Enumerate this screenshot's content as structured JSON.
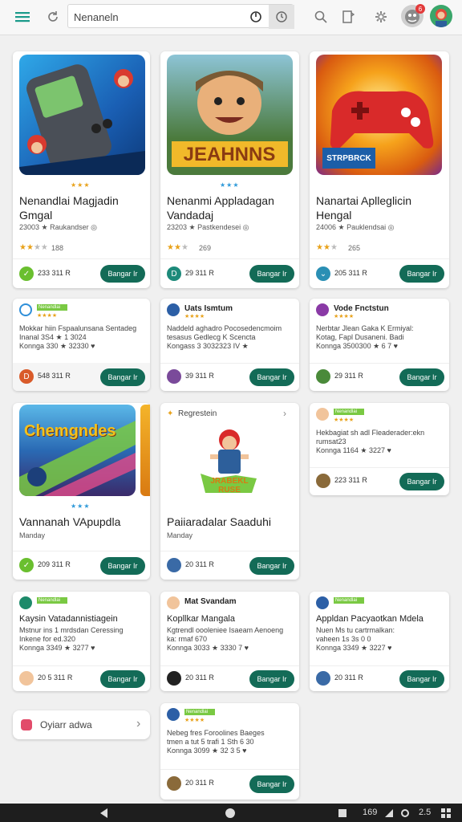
{
  "search": {
    "value": "Nenaneln"
  },
  "colors": {
    "accent": "#136b57",
    "star": "#e8a21b",
    "tag": "#7ac943"
  },
  "icons": {
    "menu": "hamburger-menu-icon",
    "refresh": "refresh-icon",
    "mic": "microphone-icon",
    "scan": "scan-icon",
    "search": "search-icon",
    "bookmark": "bookmark-icon",
    "settings": "gear-icon",
    "notifications": "bell-avatar-icon",
    "profile": "profile-avatar-icon"
  },
  "notification_count": "6",
  "featured": [
    {
      "title1": "Nenandlai Magjadin",
      "title2": "Gmgal",
      "meta": "23003 ★ Raukandser ◎",
      "stars": "★★",
      "grey": "★★",
      "count": "188",
      "price": "233 311 R",
      "button": "Bangar Ir"
    },
    {
      "title1": "Nenanmi Appladagan",
      "title2": "Vandadaj",
      "meta": "23203 ★ Pastkendesei ◎",
      "stars": "★★",
      "grey": "★",
      "count": "269",
      "price": "29 311 R",
      "button": "Bangar Ir"
    },
    {
      "title1": "Nanartai Aplleglicin",
      "title2": "Hengal",
      "meta": "24006 ★ Pauklendsai ◎",
      "stars": "★★",
      "grey": "★",
      "count": "265",
      "price": "205 311 R",
      "button": "Bangar Ir"
    }
  ],
  "row2": [
    {
      "tag": "Nenandlai",
      "title": "",
      "desc": [
        "Mokkar hiin Fspaalunsana Sentadeg",
        "Inanal 3S4 ★ 1 3024",
        "Konnga 330 ★ 32330 ♥"
      ],
      "price": "548 311 R",
      "button": "Bangar Ir"
    },
    {
      "tag": "",
      "title": "Uats Ismtum",
      "desc": [
        "Naddeld aghadro Pocosedencmoim",
        "tesasus Gedlecg K Scencta",
        "Kongass 3 3032323 IV ★"
      ],
      "price": "39 311 R",
      "button": "Bangar Ir"
    },
    {
      "tag": "",
      "title": "Vode Fnctstun",
      "desc": [
        "Nerbtar Jlean Gaka K Ermiyal:",
        "Kotag, Fapl Dusaneni. Badi",
        "Konnga 3500300 ★ 6 7 ♥"
      ],
      "price": "29 311 R",
      "button": "Bangar Ir"
    }
  ],
  "row3": {
    "game": {
      "banner": "Chemgndes",
      "title": "Vannanah VApupdla",
      "sub": "Manday",
      "price": "209 311 R",
      "button": "Bangar Ir"
    },
    "mid": {
      "header": "Regrestein",
      "banner": "JRABEKL RUSE",
      "title": "Paiiaradalar Saaduhi",
      "sub": "Manday",
      "price": "20 311 R",
      "button": "Bangar Ir"
    },
    "right": {
      "tag": "Nenandlai",
      "desc": [
        "Hekbagiat sh adl Fleaderader:ekn",
        "rumsat23",
        "Konnga 1164 ★ 3227 ♥"
      ],
      "price": "223 311 R",
      "button": "Bangar Ir"
    }
  },
  "row4": [
    {
      "tag": "Nenandlai",
      "title": "Kaysin Vatadannistiagein",
      "desc": [
        "Mstnur ins 1 mrdsdan Ceressing",
        "Inkene for ed.320",
        "Konnga 3349 ★ 3277 ♥"
      ],
      "price": "20 5 311 R",
      "button": "Bangar Ir"
    },
    {
      "tag": "",
      "title": "Kopllkar Mangala",
      "desc": [
        "Kgtrendl oooleniee Isaeam Aenoeng",
        "ka: rmaf 670",
        "Konnga 3033 ★ 3330 7 ♥"
      ],
      "price": "20 311 R",
      "button": "Bangar Ir"
    },
    {
      "tag": "Nenandlai",
      "title": "Appldan Pacyaotkan Mdela",
      "desc": [
        "Nuen Ms tu cartrmalkan:",
        "vaheen 1s 3s 0 0",
        "Konnga 3349 ★ 3227 ♥"
      ],
      "price": "20 311 R",
      "button": "Bangar Ir"
    }
  ],
  "pill_label": "Oyiarr adwa",
  "row5": {
    "tag": "Nenandlai",
    "desc": [
      "Nebeg fres Foroolines Baeges",
      "tmen a tut 5 trafi 1 Sth 6 30",
      "Konnga 3099 ★ 32 3 5 ♥"
    ],
    "price": "20 311 R",
    "button": "Bangar Ir"
  },
  "status": {
    "time": "169",
    "text2": "2.5"
  }
}
